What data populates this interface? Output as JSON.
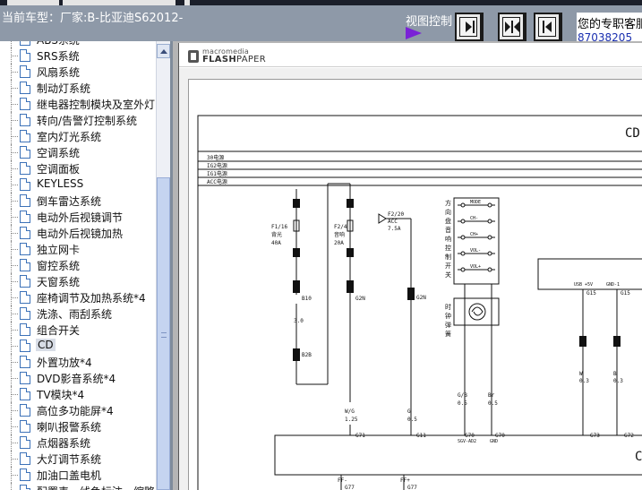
{
  "header": {
    "car_type_label": "当前车型：厂家:B-比亚迪S62012-",
    "view_control_label": "视图控制",
    "support_line1": "您的专职客服",
    "support_line2": "87038205",
    "buttons": [
      {
        "name": "expand-right-button",
        "icon": "arrow-right-bar-icon"
      },
      {
        "name": "split-view-button",
        "icon": "split-arrows-icon"
      },
      {
        "name": "collapse-left-button",
        "icon": "arrow-left-bar-icon"
      }
    ]
  },
  "sidebar": {
    "items": [
      {
        "label": "ABS系统"
      },
      {
        "label": "SRS系统"
      },
      {
        "label": "风扇系统"
      },
      {
        "label": "制动灯系统"
      },
      {
        "label": "继电器控制模块及室外灯"
      },
      {
        "label": "转向/告警灯控制系统"
      },
      {
        "label": "室内灯光系统"
      },
      {
        "label": "空调系统"
      },
      {
        "label": "空调面板"
      },
      {
        "label": "KEYLESS"
      },
      {
        "label": "倒车雷达系统"
      },
      {
        "label": "电动外后视镜调节"
      },
      {
        "label": "电动外后视镜加热"
      },
      {
        "label": "独立网卡"
      },
      {
        "label": "窗控系统"
      },
      {
        "label": "天窗系统"
      },
      {
        "label": "座椅调节及加热系统*4"
      },
      {
        "label": "洗涤、雨刮系统"
      },
      {
        "label": "组合开关"
      },
      {
        "label": "CD",
        "selected": true
      },
      {
        "label": "外置功放*4"
      },
      {
        "label": "DVD影音系统*4"
      },
      {
        "label": "TV模块*4"
      },
      {
        "label": "高位多功能屏*4"
      },
      {
        "label": "喇叭报警系统"
      },
      {
        "label": "点烟器系统"
      },
      {
        "label": "大灯调节系统"
      },
      {
        "label": "加油口盖电机"
      },
      {
        "label": "配置表、线色标注、缩略"
      }
    ]
  },
  "viewer": {
    "brand_small": "macromedia",
    "brand_main": "FLASH",
    "brand_suffix": "PAPER"
  },
  "schematic": {
    "page_code": "CD",
    "rails": [
      "30电源",
      "IG2电源",
      "IG1电源",
      "ACC电源"
    ],
    "fuses": [
      {
        "id": "F1/16",
        "name": "背光",
        "rating": "40A"
      },
      {
        "id": "F2/4",
        "name": "音响",
        "rating": "20A"
      },
      {
        "id": "F2/20",
        "name": "ACC",
        "rating": "7.5A"
      }
    ],
    "connectors": [
      "B10",
      "G2N",
      "B2B",
      "G2N",
      "G71",
      "G11",
      "G70",
      "G70",
      "G77",
      "G77",
      "G73",
      "G72",
      "G15",
      "G15"
    ],
    "wires": [
      {
        "color": "W/G",
        "size": "1.25"
      },
      {
        "color": "G",
        "size": "0.5"
      },
      {
        "color": "G/B",
        "size": "0.5"
      },
      {
        "color": "Br",
        "size": "0.5"
      },
      {
        "color": "LG",
        "size": "0.85"
      },
      {
        "color": "G/B",
        "size": "0.85"
      },
      {
        "color": "W",
        "size": "0.3"
      },
      {
        "color": "B",
        "size": "0.3"
      }
    ],
    "labels": {
      "switch_title": "方向盘音响控制开关",
      "mode": "MODE",
      "ch_minus": "CH-",
      "ch_plus": "CH+",
      "vol_minus": "VOL-",
      "vol_plus": "VOL+",
      "clock": "时钟弹簧",
      "ground1": "SGV-AD2",
      "ground2": "GND",
      "usb": "USB +5V",
      "gnd_short": "GND-1",
      "w_3": "3.0",
      "ff_minus": "FF-",
      "ff_plus": "FF+",
      "c_letter": "C"
    }
  }
}
